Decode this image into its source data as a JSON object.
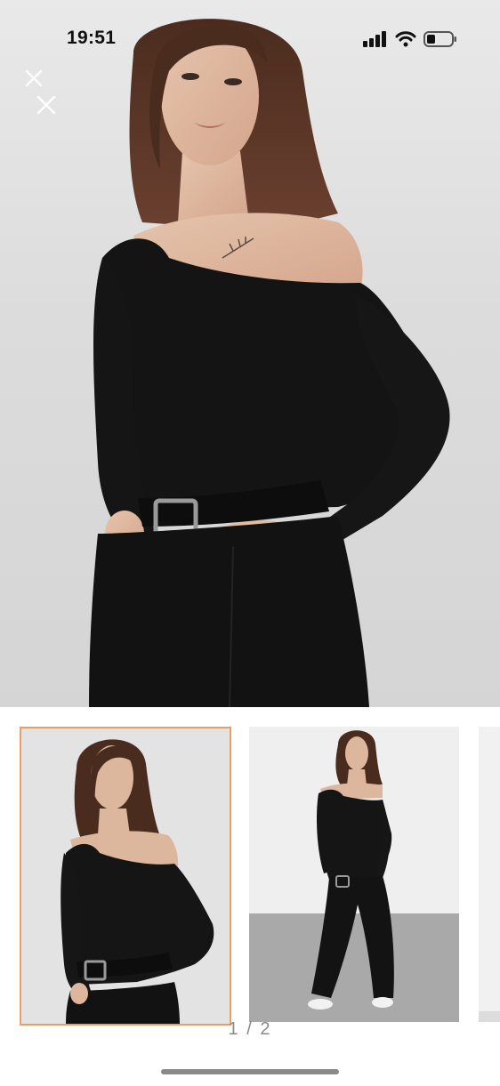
{
  "status_bar": {
    "time": "19:51",
    "icons": [
      "signal-icon",
      "wifi-icon",
      "battery-icon"
    ]
  },
  "viewer": {
    "close_icons": [
      "close-icon",
      "close-icon"
    ],
    "main_image": "model-off-shoulder-black-top-photo"
  },
  "gallery": {
    "thumbnails": [
      {
        "name": "thumbnail-closeup",
        "selected": true
      },
      {
        "name": "thumbnail-full-body",
        "selected": false
      },
      {
        "name": "thumbnail-partial",
        "selected": false
      }
    ],
    "page_indicator": "1 / 2",
    "selected_border_color": "#e8a063"
  }
}
